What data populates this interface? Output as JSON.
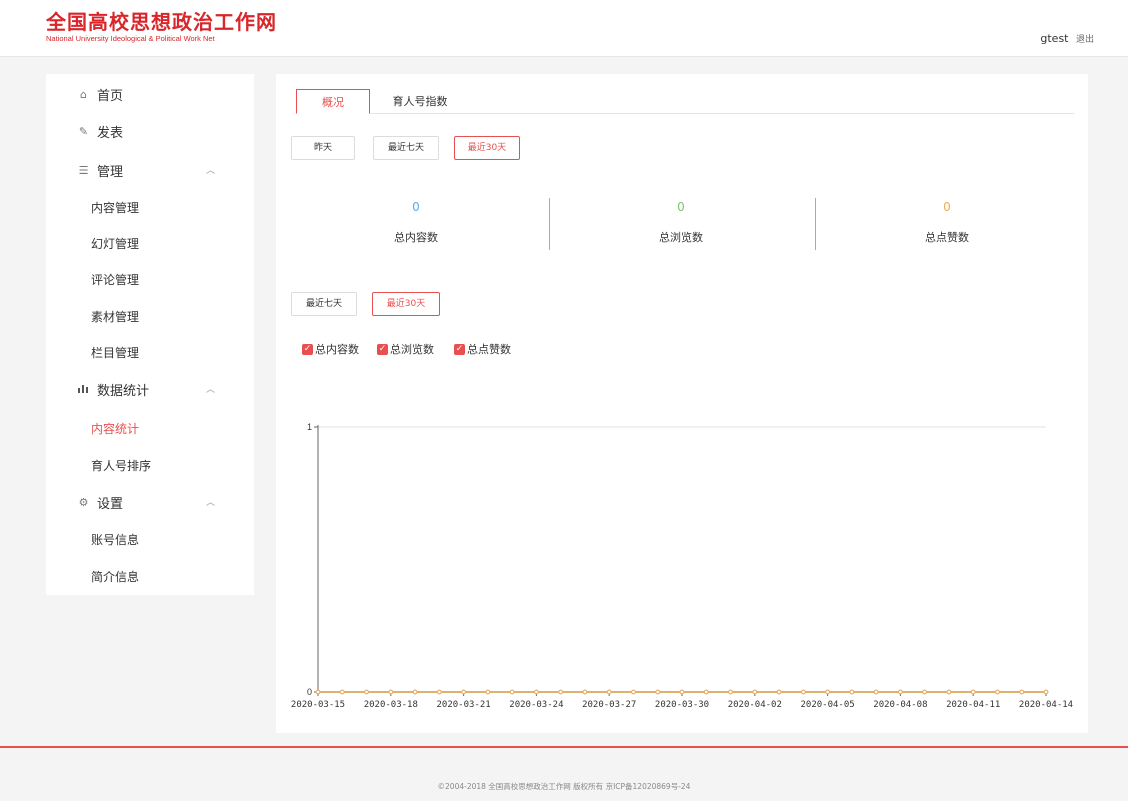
{
  "header": {
    "logo_cn": "全国高校思想政治工作网",
    "logo_en": "National University Ideological & Political Work Net",
    "username": "gtest",
    "logout_label": "退出"
  },
  "sidebar": {
    "home": {
      "label": "首页",
      "icon": "home-icon"
    },
    "publish": {
      "label": "发表",
      "icon": "edit-icon"
    },
    "manage": {
      "label": "管理",
      "icon": "document-icon",
      "expanded": true
    },
    "manage_items": [
      "内容管理",
      "幻灯管理",
      "评论管理",
      "素材管理",
      "栏目管理"
    ],
    "stats": {
      "label": "数据统计",
      "icon": "bar-chart-icon",
      "expanded": true
    },
    "stats_items": [
      "内容统计",
      "育人号排序"
    ],
    "stats_active": "内容统计",
    "settings": {
      "label": "设置",
      "icon": "gear-icon",
      "expanded": true
    },
    "settings_items": [
      "账号信息",
      "简介信息"
    ]
  },
  "tabs": [
    {
      "label": "概况",
      "active": true
    },
    {
      "label": "育人号指数",
      "active": false
    }
  ],
  "range_buttons": [
    {
      "label": "昨天",
      "active": false
    },
    {
      "label": "最近七天",
      "active": false
    },
    {
      "label": "最近30天",
      "active": true
    }
  ],
  "stats": [
    {
      "value": "0",
      "label": "总内容数",
      "color": "#5aaef0"
    },
    {
      "value": "0",
      "label": "总浏览数",
      "color": "#7ec66a"
    },
    {
      "value": "0",
      "label": "总点赞数",
      "color": "#f3a95b"
    }
  ],
  "chart_range_buttons": [
    {
      "label": "最近七天",
      "active": false
    },
    {
      "label": "最近30天",
      "active": true
    }
  ],
  "legend": [
    {
      "label": "总内容数",
      "checked": true
    },
    {
      "label": "总浏览数",
      "checked": true
    },
    {
      "label": "总点赞数",
      "checked": true
    }
  ],
  "chart_data": {
    "type": "line",
    "x": [
      "2020-03-15",
      "2020-03-16",
      "2020-03-17",
      "2020-03-18",
      "2020-03-19",
      "2020-03-20",
      "2020-03-21",
      "2020-03-22",
      "2020-03-23",
      "2020-03-24",
      "2020-03-25",
      "2020-03-26",
      "2020-03-27",
      "2020-03-28",
      "2020-03-29",
      "2020-03-30",
      "2020-03-31",
      "2020-04-01",
      "2020-04-02",
      "2020-04-03",
      "2020-04-04",
      "2020-04-05",
      "2020-04-06",
      "2020-04-07",
      "2020-04-08",
      "2020-04-09",
      "2020-04-10",
      "2020-04-11",
      "2020-04-12",
      "2020-04-13",
      "2020-04-14"
    ],
    "x_tick_labels": [
      "2020-03-15",
      "2020-03-18",
      "2020-03-21",
      "2020-03-24",
      "2020-03-27",
      "2020-03-30",
      "2020-04-02",
      "2020-04-05",
      "2020-04-08",
      "2020-04-11",
      "2020-04-14"
    ],
    "y_tick_labels": [
      "0",
      "1"
    ],
    "ylim": [
      0,
      1
    ],
    "series": [
      {
        "name": "总内容数",
        "values": [
          0,
          0,
          0,
          0,
          0,
          0,
          0,
          0,
          0,
          0,
          0,
          0,
          0,
          0,
          0,
          0,
          0,
          0,
          0,
          0,
          0,
          0,
          0,
          0,
          0,
          0,
          0,
          0,
          0,
          0,
          0
        ],
        "color": "#5aaef0"
      },
      {
        "name": "总浏览数",
        "values": [
          0,
          0,
          0,
          0,
          0,
          0,
          0,
          0,
          0,
          0,
          0,
          0,
          0,
          0,
          0,
          0,
          0,
          0,
          0,
          0,
          0,
          0,
          0,
          0,
          0,
          0,
          0,
          0,
          0,
          0,
          0
        ],
        "color": "#7ec66a"
      },
      {
        "name": "总点赞数",
        "values": [
          0,
          0,
          0,
          0,
          0,
          0,
          0,
          0,
          0,
          0,
          0,
          0,
          0,
          0,
          0,
          0,
          0,
          0,
          0,
          0,
          0,
          0,
          0,
          0,
          0,
          0,
          0,
          0,
          0,
          0,
          0
        ],
        "color": "#f3a95b"
      }
    ],
    "grid": true,
    "legend_position": "top-left",
    "title": "",
    "xlabel": "",
    "ylabel": ""
  },
  "footer": {
    "copyright": "©2004-2018 全国高校思想政治工作网 版权所有 京ICP备12020869号-24"
  }
}
